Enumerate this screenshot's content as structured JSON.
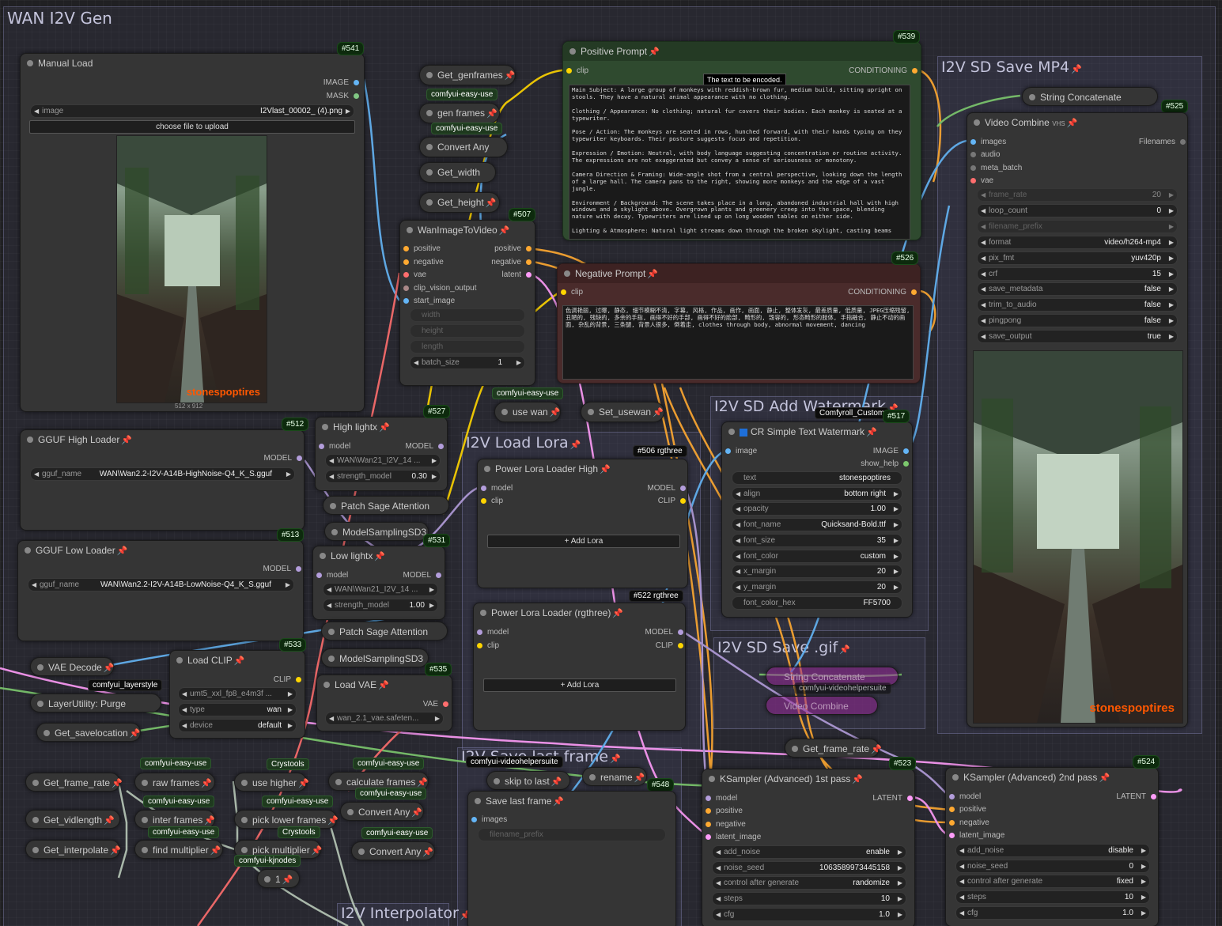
{
  "colors": {
    "image": "#64b5f6",
    "mask": "#81c784",
    "model": "#b39ddb",
    "clip": "#ffd500",
    "vae": "#ff6e6e",
    "latent": "#ff9cf9",
    "conditioning": "#ffa931",
    "string": "#7cc86d",
    "int": "#8ab4f8",
    "pin": "#e34242"
  },
  "groups": {
    "wan": "WAN I2V Gen",
    "save_mp4": "I2V SD Save MP4",
    "load_lora": "I2V Load Lora",
    "watermark": "I2V SD Add Watermark",
    "save_gif": "I2V SD Save .gif",
    "last_frame": "I2V Save last frame",
    "interpolator": "I2V Interpolator"
  },
  "manual_load": {
    "title": "Manual Load",
    "id": "#541",
    "outputs": [
      "IMAGE",
      "MASK"
    ],
    "image_label": "image",
    "image_value": "I2Vlast_00002_ (4).png",
    "upload": "choose file to upload",
    "size": "512 x 912",
    "watermark": "stonespoptires"
  },
  "getters": {
    "genframes": "Get_genframes",
    "gen_frames": "gen frames",
    "convert_any": "Convert Any",
    "width": "Get_width",
    "height": "Get_height",
    "frame_rate": "Get_frame_rate",
    "vidlength": "Get_vidlength",
    "interpolate": "Get_interpolate",
    "savelocation": "Get_savelocation",
    "frame_rate2": "Get_frame_rate"
  },
  "tags": {
    "easy": "comfyui-easy-use",
    "layerstyle": "comfyui_layerstyle",
    "crys": "Crystools",
    "kj": "comfyui-kjnodes",
    "vhp": "comfyui-videohelpersuite",
    "comfyroll": "Comfyroll_Custom",
    "r506": "#506 rgthree",
    "r522": "#522 rgthree"
  },
  "positive": {
    "title": "Positive Prompt",
    "id": "#539",
    "in": "clip",
    "out": "CONDITIONING",
    "tooltip": "The text to be encoded.",
    "text": "Main Subject: A large group of monkeys with reddish-brown fur, medium build, sitting upright on stools. They have a natural animal appearance with no clothing.\n\nClothing / Appearance: No clothing; natural fur covers their bodies. Each monkey is seated at a typewriter.\n\nPose / Action: The monkeys are seated in rows, hunched forward, with their hands typing on they typewriter keyboards. Their posture suggests focus and repetition.\n\nExpression / Emotion: Neutral, with body language suggesting concentration or routine activity. The expressions are not exaggerated but convey a sense of seriousness or monotony.\n\nCamera Direction & Framing: Wide-angle shot from a central perspective, looking down the length of a large hall. The camera pans to the right, showing more monkeys and the edge of a vast jungle.\n\nEnvironment / Background: The scene takes place in a long, abandoned industrial hall with high windows and a skylight above. Overgrown plants and greenery creep into the space, blending nature with decay. Typewriters are lined up on long wooden tables on either side.\n\nLighting & Atmosphere: Natural light streams down through the broken skylight, casting beams"
  },
  "negative": {
    "title": "Negative Prompt",
    "id": "#526",
    "in": "clip",
    "out": "CONDITIONING",
    "text": "色调艳丽, 过曝, 静态, 细节模糊不清, 字幕, 风格, 作品, 画作, 画面, 静止, 整体发灰, 最差质量, 低质量, JPEG压缩残留, 丑陋的, 残缺的, 多余的手指, 画得不好的手部, 画得不好的脸部, 畸形的, 毁容的, 形态畸形的肢体, 手指融合, 静止不动的画面, 杂乱的背景, 三条腿, 背景人很多, 倒着走, clothes through body, abnormal movement, dancing"
  },
  "wan_i2v": {
    "title": "WanImageToVideo",
    "id": "#507",
    "inputs": [
      "positive",
      "negative",
      "vae",
      "clip_vision_output",
      "start_image"
    ],
    "outputs": [
      "positive",
      "negative",
      "latent"
    ],
    "widgets": [
      {
        "label": "width",
        "value": ""
      },
      {
        "label": "height",
        "value": ""
      },
      {
        "label": "length",
        "value": ""
      },
      {
        "label": "batch_size",
        "value": "1"
      }
    ]
  },
  "use_wan": {
    "a": "use wan",
    "b": "Set_usewan"
  },
  "gguf_high": {
    "title": "GGUF High Loader",
    "id": "#512",
    "out": "MODEL",
    "label": "gguf_name",
    "value": "WAN\\Wan2.2-I2V-A14B-HighNoise-Q4_K_S.gguf"
  },
  "gguf_low": {
    "title": "GGUF Low Loader",
    "id": "#513",
    "out": "MODEL",
    "label": "gguf_name",
    "value": "WAN\\Wan2.2-I2V-A14B-LowNoise-Q4_K_S.gguf"
  },
  "high_lightx": {
    "title": "High lightx",
    "id": "#527",
    "in": "model",
    "out": "MODEL",
    "lora": "WAN\\Wan21_I2V_14 ...",
    "strength_label": "strength_model",
    "strength": "0.30"
  },
  "low_lightx": {
    "title": "Low lightx",
    "id": "#531",
    "in": "model",
    "out": "MODEL",
    "lora": "WAN\\Wan21_I2V_14 ...",
    "strength_label": "strength_model",
    "strength": "1.00"
  },
  "patch_sage": "Patch Sage Attention",
  "model_sampling": "ModelSamplingSD3",
  "vae_decode": "VAE Decode",
  "purge": "LayerUtility: Purge",
  "load_clip": {
    "title": "Load CLIP",
    "id": "#533",
    "out": "CLIP",
    "clip": "umt5_xxl_fp8_e4m3f ...",
    "type_label": "type",
    "type": "wan",
    "device_label": "device",
    "device": "default"
  },
  "load_vae": {
    "title": "Load VAE",
    "id": "#535",
    "out": "VAE",
    "vae": "wan_2.1_vae.safeten..."
  },
  "pl_high": {
    "title": "Power Lora Loader High",
    "inputs": [
      "model",
      "clip"
    ],
    "outputs": [
      "MODEL",
      "CLIP"
    ],
    "add": "Add Lora"
  },
  "pl_rg": {
    "title": "Power Lora Loader (rgthree)",
    "inputs": [
      "model",
      "clip"
    ],
    "outputs": [
      "MODEL",
      "CLIP"
    ],
    "add": "Add Lora"
  },
  "watermark": {
    "title": "CR Simple Text Watermark",
    "id": "#517",
    "in": "image",
    "outputs": [
      "IMAGE",
      "show_help"
    ],
    "widgets": [
      {
        "label": "text",
        "value": "stonespoptires",
        "arrows": false
      },
      {
        "label": "align",
        "value": "bottom right",
        "arrows": true
      },
      {
        "label": "opacity",
        "value": "1.00",
        "arrows": true
      },
      {
        "label": "font_name",
        "value": "Quicksand-Bold.ttf",
        "arrows": true
      },
      {
        "label": "font_size",
        "value": "35",
        "arrows": true
      },
      {
        "label": "font_color",
        "value": "custom",
        "arrows": true
      },
      {
        "label": "x_margin",
        "value": "20",
        "arrows": true
      },
      {
        "label": "y_margin",
        "value": "20",
        "arrows": true
      },
      {
        "label": "font_color_hex",
        "value": "FF5700",
        "arrows": false
      }
    ]
  },
  "string_concat": {
    "title": "String Concatenate",
    "id": "#525"
  },
  "video_combine": {
    "title": "Video Combine",
    "vhs": "VHS",
    "inputs": [
      "images",
      "audio",
      "meta_batch",
      "vae"
    ],
    "out": "Filenames",
    "widgets": [
      {
        "label": "frame_rate",
        "value": "20",
        "dim": true
      },
      {
        "label": "loop_count",
        "value": "0",
        "dim": false
      },
      {
        "label": "filename_prefix",
        "value": "",
        "dim": true
      },
      {
        "label": "format",
        "value": "video/h264-mp4",
        "dim": false
      },
      {
        "label": "pix_fmt",
        "value": "yuv420p",
        "dim": false
      },
      {
        "label": "crf",
        "value": "15",
        "dim": false
      },
      {
        "label": "save_metadata",
        "value": "false",
        "dim": false
      },
      {
        "label": "trim_to_audio",
        "value": "false",
        "dim": false
      },
      {
        "label": "pingpong",
        "value": "false",
        "dim": false
      },
      {
        "label": "save_output",
        "value": "true",
        "dim": false
      }
    ],
    "watermark": "stonespoptires"
  },
  "gif_nodes": {
    "concat": "String Concatenate",
    "combine": "Video Combine",
    "vhp": "comfyui-videohelpersuite"
  },
  "frames": {
    "raw": "raw frames",
    "use_higher": "use higher",
    "calc": "calculate frames",
    "inter": "inter frames",
    "pick_lower": "pick lower frames",
    "convert": "Convert Any",
    "find_mult": "find multiplier",
    "pick_mult": "pick multiplier",
    "convert2": "Convert Any",
    "one": "1"
  },
  "last_frame": {
    "skip": "skip to last",
    "rename": "rename",
    "id": "#548",
    "title": "Save last frame",
    "in": "images",
    "widget": "filename_prefix"
  },
  "ks1": {
    "title": "KSampler (Advanced) 1st pass",
    "id": "#523",
    "inputs": [
      "model",
      "positive",
      "negative",
      "latent_image"
    ],
    "out": "LATENT",
    "widgets": [
      {
        "label": "add_noise",
        "value": "enable"
      },
      {
        "label": "noise_seed",
        "value": "1063589973445158"
      },
      {
        "label": "control after generate",
        "value": "randomize"
      },
      {
        "label": "steps",
        "value": "10"
      },
      {
        "label": "cfg",
        "value": "1.0"
      }
    ]
  },
  "ks2": {
    "title": "KSampler (Advanced) 2nd pass",
    "id": "#524",
    "inputs": [
      "model",
      "positive",
      "negative",
      "latent_image"
    ],
    "out": "LATENT",
    "widgets": [
      {
        "label": "add_noise",
        "value": "disable"
      },
      {
        "label": "noise_seed",
        "value": "0"
      },
      {
        "label": "control after generate",
        "value": "fixed"
      },
      {
        "label": "steps",
        "value": "10"
      },
      {
        "label": "cfg",
        "value": "1.0"
      }
    ]
  }
}
